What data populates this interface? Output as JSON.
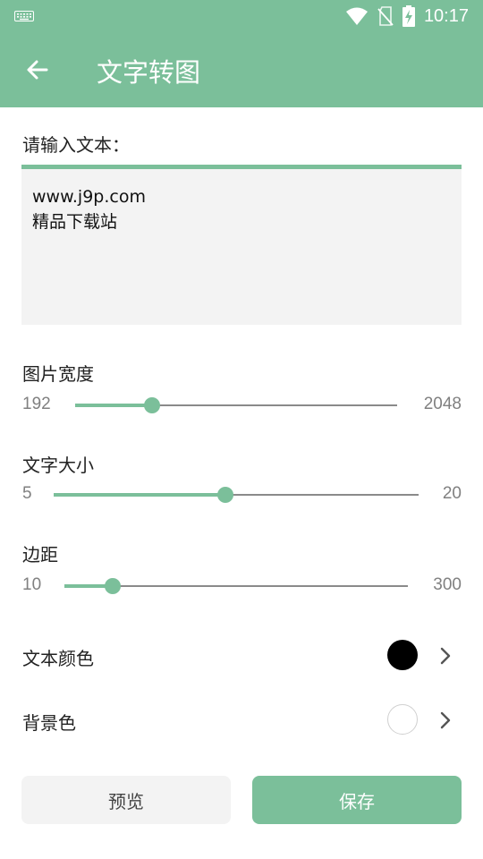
{
  "status_bar": {
    "time": "10:17",
    "icons": [
      "keyboard-icon",
      "wifi-icon",
      "no-sim-icon",
      "battery-charging-icon"
    ]
  },
  "app_bar": {
    "title": "文字转图",
    "back_icon": "arrow-left-icon"
  },
  "text_input": {
    "label": "请输入文本：",
    "lines": [
      "www.j9p.com",
      "精品下载站"
    ]
  },
  "sliders": [
    {
      "label": "图片宽度",
      "min": "192",
      "max": "2048",
      "position_fraction": 0.24
    },
    {
      "label": "文字大小",
      "min": "5",
      "max": "20",
      "position_fraction": 0.47
    },
    {
      "label": "边距",
      "min": "10",
      "max": "300",
      "position_fraction": 0.14
    }
  ],
  "colors": {
    "text_color": {
      "label": "文本颜色",
      "value": "#000000"
    },
    "background_color": {
      "label": "背景色",
      "value": "#ffffff"
    }
  },
  "buttons": {
    "preview_label": "预览",
    "save_label": "保存"
  },
  "theme": {
    "accent": "#7bbf9a",
    "muted_text": "#808080"
  }
}
